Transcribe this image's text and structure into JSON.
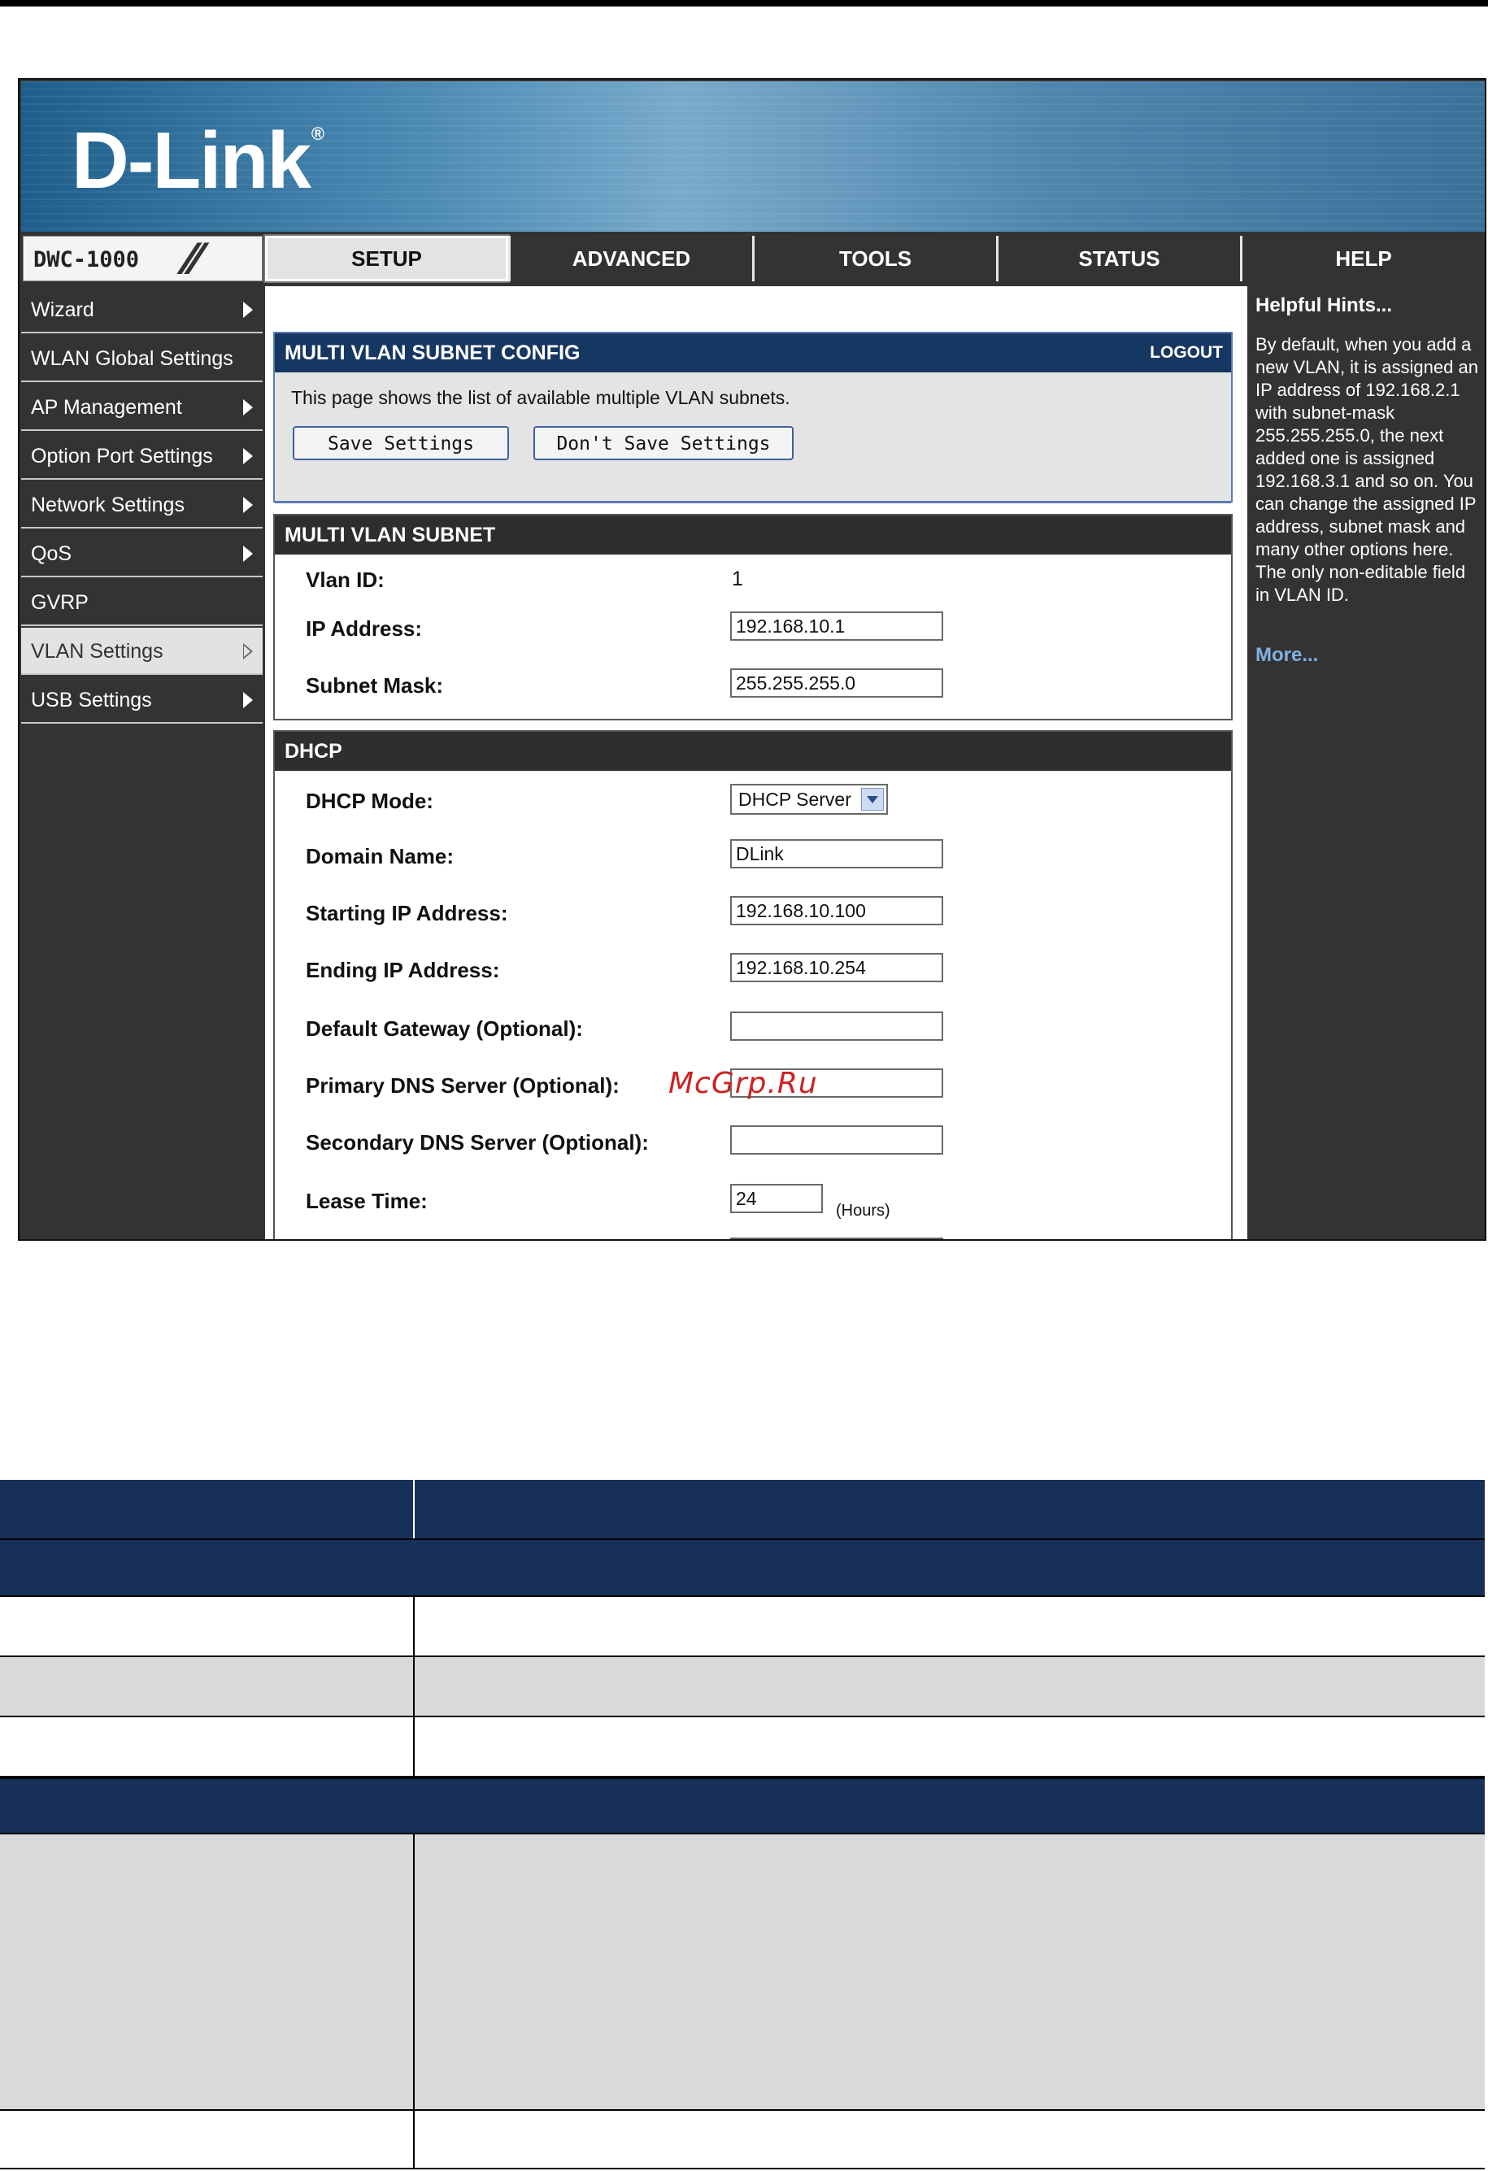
{
  "brand": {
    "logo_text": "D-Link",
    "logo_mark": "®",
    "model": "DWC-1000"
  },
  "tabs": [
    {
      "label": "SETUP",
      "active": true
    },
    {
      "label": "ADVANCED",
      "active": false
    },
    {
      "label": "TOOLS",
      "active": false
    },
    {
      "label": "STATUS",
      "active": false
    },
    {
      "label": "HELP",
      "active": false
    }
  ],
  "sidebar": {
    "items": [
      {
        "label": "Wizard",
        "arrow": "right-filled"
      },
      {
        "label": "WLAN Global Settings",
        "arrow": "none"
      },
      {
        "label": "AP Management",
        "arrow": "right-filled"
      },
      {
        "label": "Option Port Settings",
        "arrow": "right-filled"
      },
      {
        "label": "Network Settings",
        "arrow": "right-filled"
      },
      {
        "label": "QoS",
        "arrow": "right-filled"
      },
      {
        "label": "GVRP",
        "arrow": "none"
      },
      {
        "label": "VLAN Settings",
        "arrow": "right-outline",
        "active": true
      },
      {
        "label": "USB Settings",
        "arrow": "right-filled"
      }
    ]
  },
  "config": {
    "title": "MULTI VLAN SUBNET CONFIG",
    "logout": "LOGOUT",
    "description": "This page shows the list of available multiple VLAN subnets.",
    "save_label": "Save Settings",
    "dont_save_label": "Don't Save Settings"
  },
  "subnet": {
    "title": "MULTI VLAN SUBNET",
    "vlan_id_label": "Vlan ID:",
    "vlan_id_value": "1",
    "ip_label": "IP Address:",
    "ip_value": "192.168.10.1",
    "mask_label": "Subnet Mask:",
    "mask_value": "255.255.255.0"
  },
  "dhcp": {
    "title": "DHCP",
    "mode_label": "DHCP Mode:",
    "mode_value": "DHCP Server",
    "domain_label": "Domain Name:",
    "domain_value": "DLink",
    "start_label": "Starting IP Address:",
    "start_value": "192.168.10.100",
    "end_label": "Ending IP Address:",
    "end_value": "192.168.10.254",
    "gateway_label": "Default Gateway (Optional):",
    "gateway_value": "",
    "dns1_label": "Primary DNS Server (Optional):",
    "dns1_value": "",
    "dns2_label": "Secondary DNS Server (Optional):",
    "dns2_value": "",
    "lease_label": "Lease Time:",
    "lease_value": "24",
    "lease_unit": "(Hours)"
  },
  "help": {
    "title": "Helpful Hints...",
    "text": "By default, when you add a new VLAN, it is assigned an IP address of 192.168.2.1 with subnet-mask 255.255.255.0, the next added one is assigned 192.168.3.1 and so on. You can change the assigned IP address, subnet mask and many other options here. The only non-editable field in VLAN ID.",
    "more": "More..."
  },
  "watermark": "McGrp.Ru",
  "colors": {
    "table_header": "#17305a",
    "grey_row": "#d9d9d9",
    "config_header": "#173763",
    "help_link": "#7fb2e0"
  }
}
